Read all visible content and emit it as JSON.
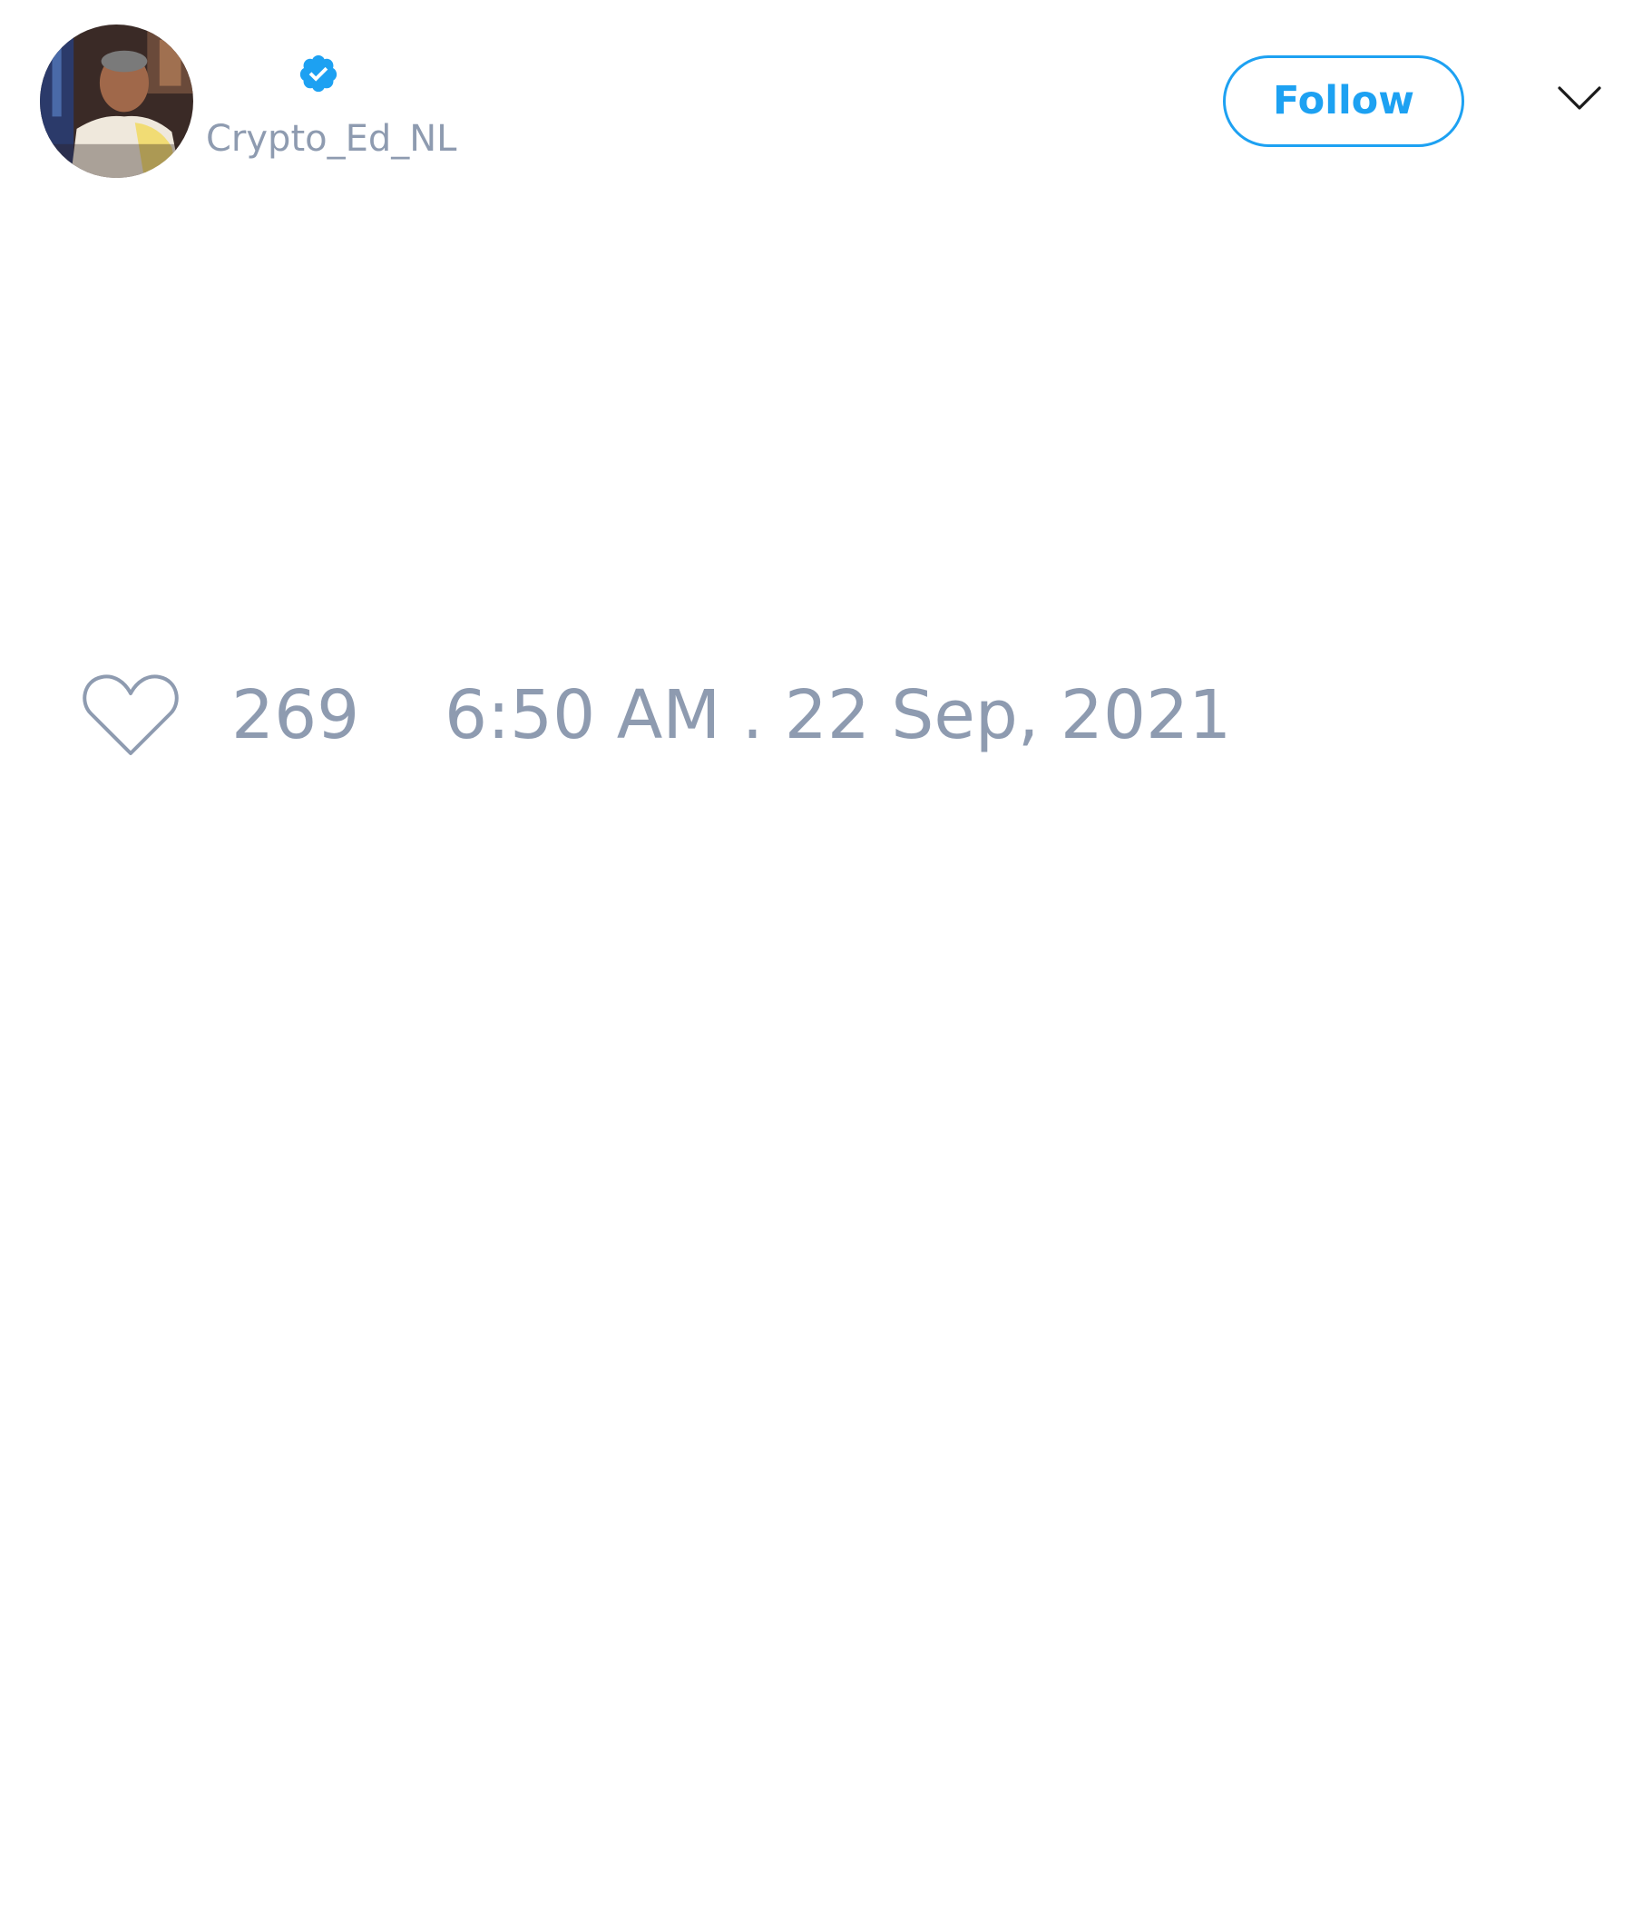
{
  "author": {
    "handle": "Crypto_Ed_NL",
    "verified": true
  },
  "header": {
    "follow_label": "Follow"
  },
  "icons": {
    "avatar": "profile-photo",
    "verified": "verified-badge-icon",
    "menu": "chevron-down-icon",
    "like": "heart-outline-icon"
  },
  "tweet": {
    "like_count": "269",
    "timestamp": "6:50 AM . 22 Sep, 2021"
  },
  "colors": {
    "accent": "#1da1f2",
    "muted_text": "#8e9bb0",
    "background": "#ffffff"
  }
}
